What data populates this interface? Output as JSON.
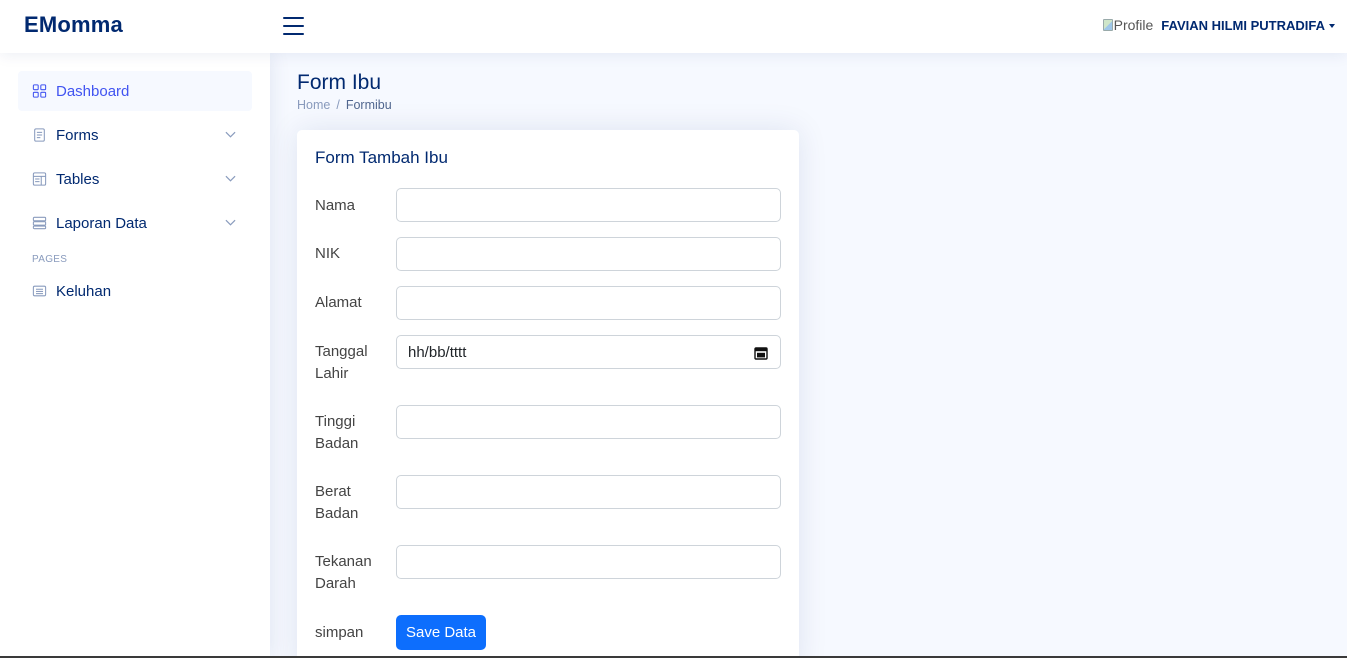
{
  "header": {
    "logo": "EMomma",
    "profile_alt": "Profile",
    "user_name": "FAVIAN HILMI PUTRADIFA"
  },
  "sidebar": {
    "items": [
      {
        "label": "Dashboard",
        "icon": "grid-icon",
        "active": true
      },
      {
        "label": "Forms",
        "icon": "journal-text-icon",
        "expandable": true
      },
      {
        "label": "Tables",
        "icon": "layout-text-window-icon",
        "expandable": true
      },
      {
        "label": "Laporan Data",
        "icon": "server-icon",
        "expandable": true
      }
    ],
    "heading": "PAGES",
    "pages": [
      {
        "label": "Keluhan",
        "icon": "card-list-icon"
      }
    ]
  },
  "main": {
    "title": "Form Ibu",
    "breadcrumb": {
      "home": "Home",
      "separator": "/",
      "current": "Formibu"
    }
  },
  "form": {
    "title": "Form Tambah Ibu",
    "fields": [
      {
        "label": "Nama",
        "value": ""
      },
      {
        "label": "NIK",
        "value": ""
      },
      {
        "label": "Alamat",
        "value": ""
      },
      {
        "label": "Tanggal Lahir",
        "value": "",
        "placeholder": "hh/bb/tttt",
        "type": "date"
      },
      {
        "label": "Tinggi Badan",
        "value": ""
      },
      {
        "label": "Berat Badan",
        "value": ""
      },
      {
        "label": "Tekanan Darah",
        "value": ""
      }
    ],
    "submit_label": "simpan",
    "submit_button": "Save Data"
  },
  "colors": {
    "brand": "#012970",
    "accent": "#4154f1",
    "primary_button": "#0d6efd",
    "background": "#f6f9ff"
  }
}
